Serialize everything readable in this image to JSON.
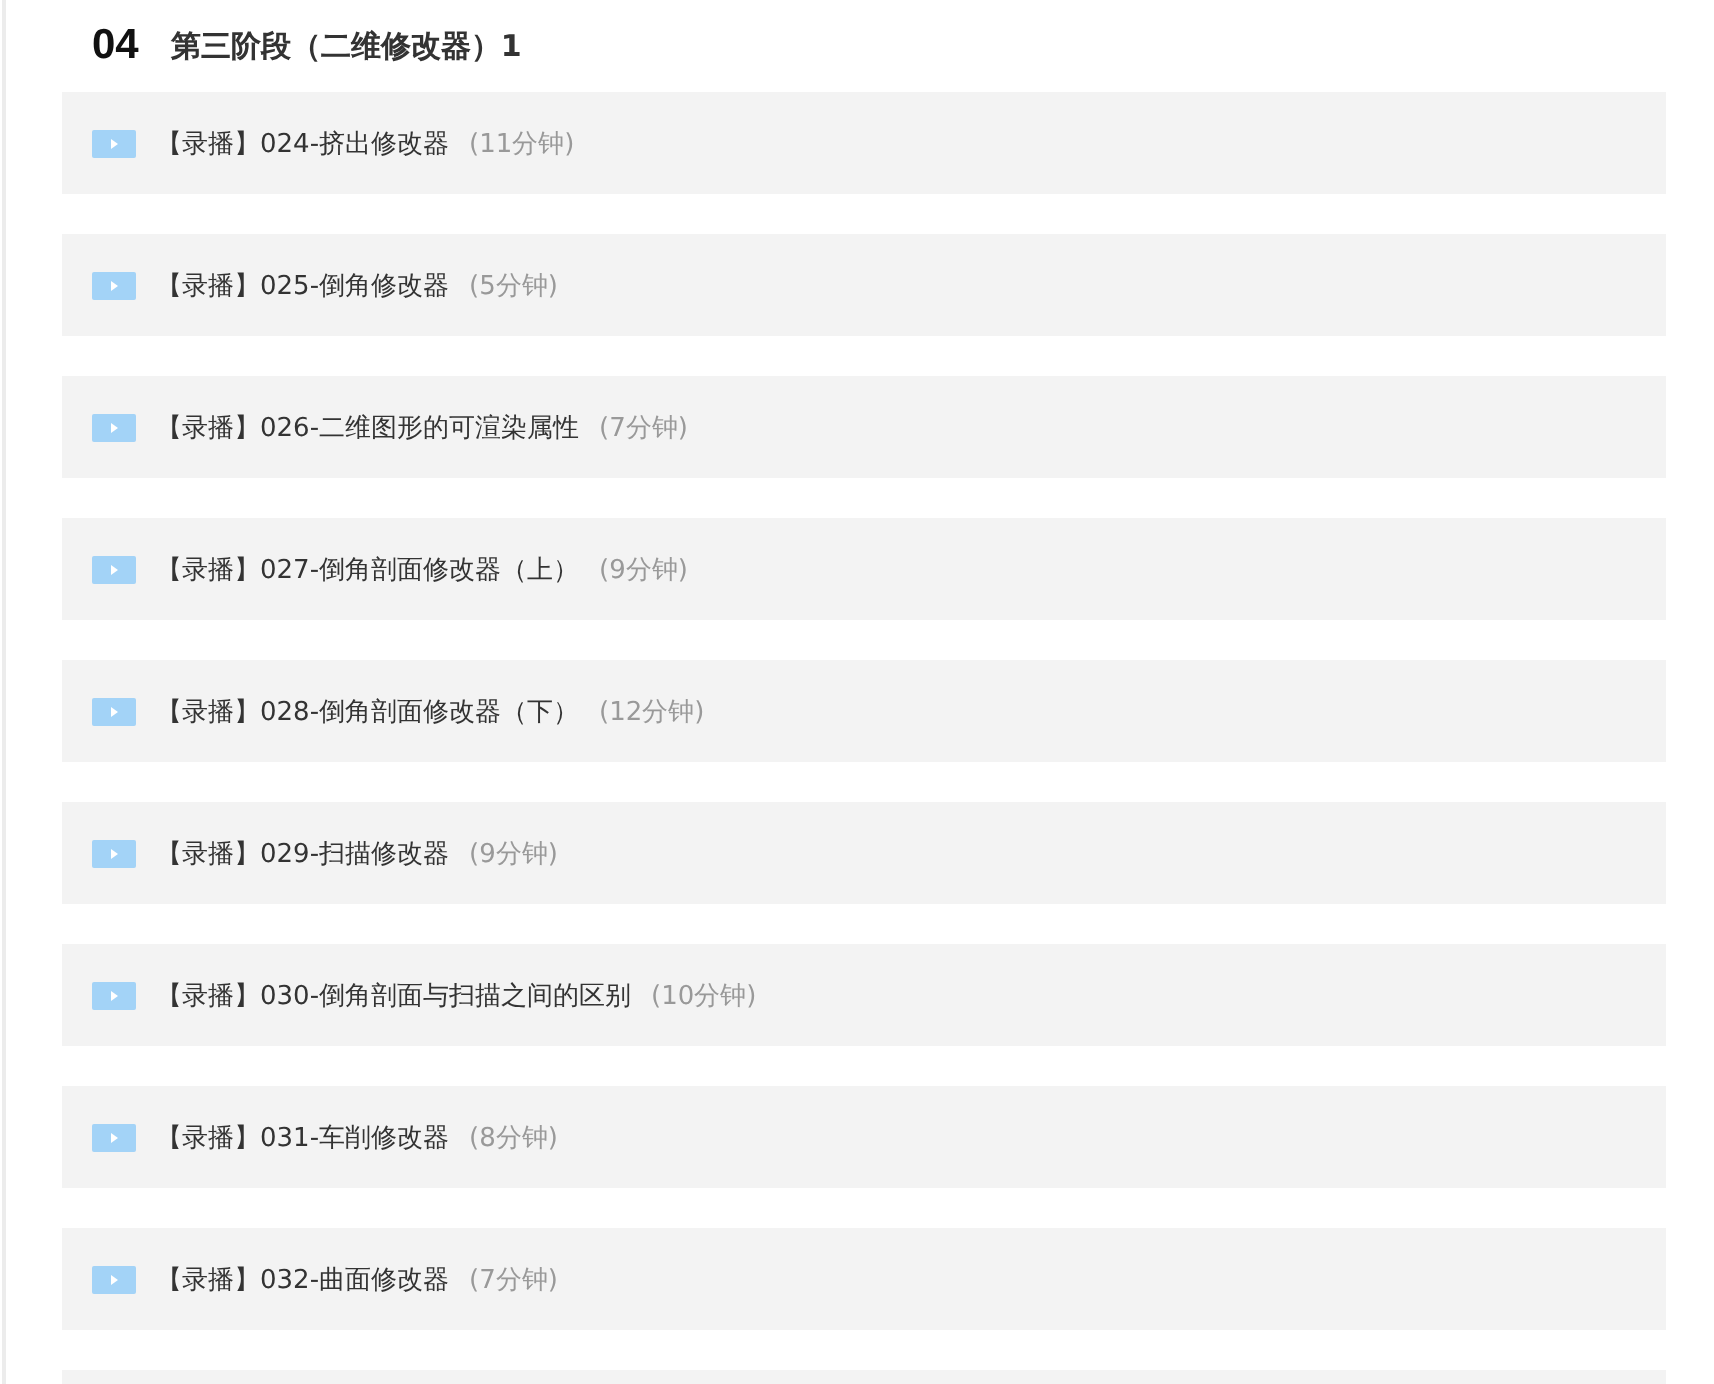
{
  "section": {
    "number": "04",
    "title": "第三阶段（二维修改器）1"
  },
  "lessons": [
    {
      "title": "【录播】024-挤出修改器",
      "duration": "(11分钟)"
    },
    {
      "title": "【录播】025-倒角修改器",
      "duration": "(5分钟)"
    },
    {
      "title": "【录播】026-二维图形的可渲染属性",
      "duration": "(7分钟)"
    },
    {
      "title": "【录播】027-倒角剖面修改器（上）",
      "duration": "(9分钟)"
    },
    {
      "title": "【录播】028-倒角剖面修改器（下）",
      "duration": "(12分钟)"
    },
    {
      "title": "【录播】029-扫描修改器",
      "duration": "(9分钟)"
    },
    {
      "title": "【录播】030-倒角剖面与扫描之间的区别",
      "duration": "(10分钟)"
    },
    {
      "title": "【录播】031-车削修改器",
      "duration": "(8分钟)"
    },
    {
      "title": "【录播】032-曲面修改器",
      "duration": "(7分钟)"
    }
  ]
}
